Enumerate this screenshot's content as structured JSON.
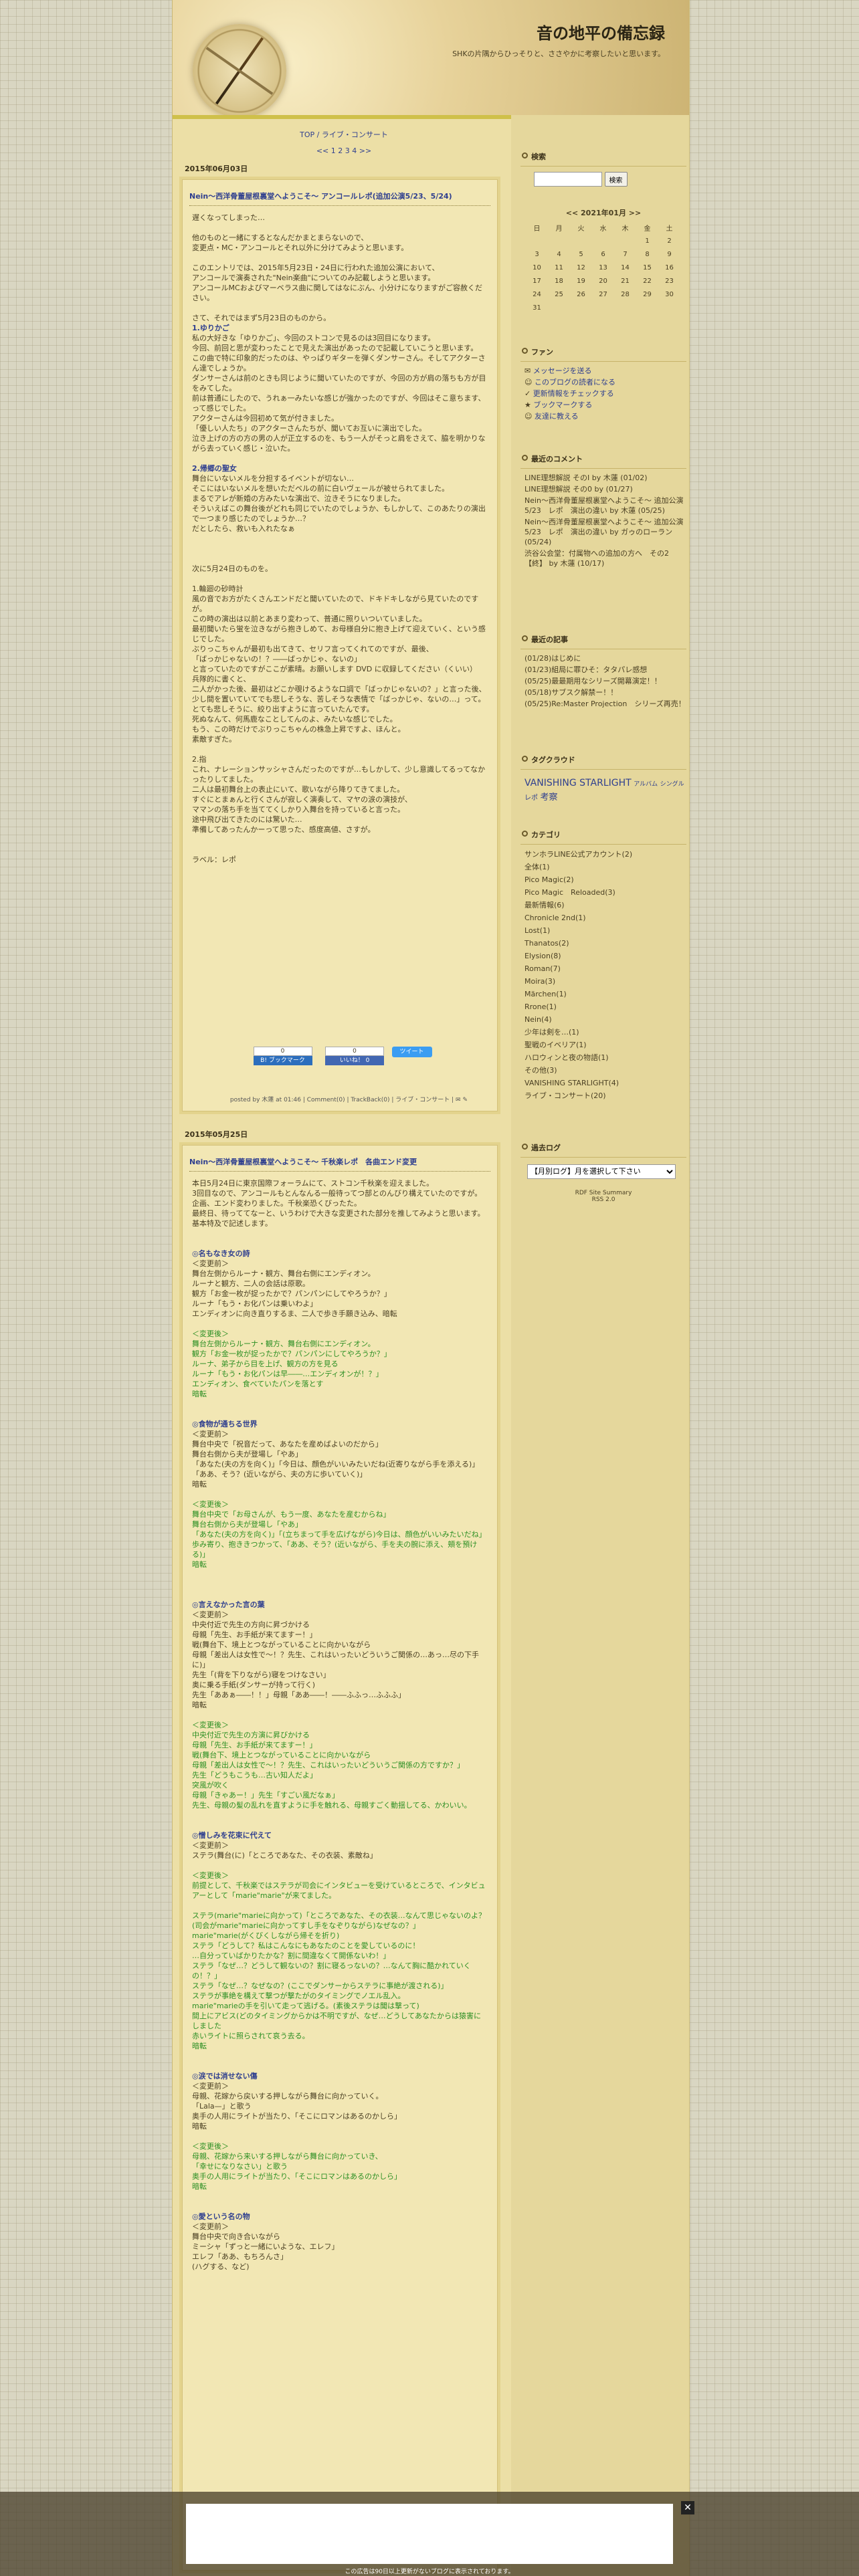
{
  "header": {
    "title": "音の地平の備忘録",
    "description": "SHKの片隅からひっそりと、ささやかに考察したいと思います。"
  },
  "nav": {
    "line1": "TOP / ライブ・コンサート",
    "line2": "<< 1 2 3 4 >>"
  },
  "entries": [
    {
      "date": "2015年06月03日",
      "title": "Nein〜西洋骨董屋根裏堂へようこそ〜 アンコールレポ(追加公演5/23、5/24)",
      "paragraphs": [
        "遅くなってしまった…",
        "他のものと一緒にするとなんだかまとまらないので、\n変更点・MC・アンコールとそれ以外に分けてみようと思います。",
        "このエントリでは、2015年5月23日・24日に行われた追加公演において、\nアンコールで演奏された\"Nein楽曲\"についてのみ記載しようと思います。\nアンコールMCおよびマーベラス曲に関してはなにぶん、小分けになりますがご容赦ください。",
        "さて、それではまず5月23日のものから。"
      ],
      "sections": [
        {
          "head": "1.ゆりかご",
          "text": "私の大好きな「ゆりかご」、今回のストコンで見るのは3回目になります。\n今回、前回と思が変わったことで見えた演出があったので記載していこうと思います。\nこの曲で特に印象的だったのは、やっぱりギターを弾くダンサーさん。そしてアクターさん達でしょうか。\nダンサーさんは前のときも同じように聞いていたのですが、今回の方が肩の落ちも方が目をみてした。\n前は普通にしたので、うれぁ一みたいな感じが強かったのですが、今回はそこ意ちます、って感じでした。\nアクターさんは今回初めて気が付きました。\n「優しい人たち」のアクターさんたちが、聞いてお互いに演出でした。\n泣き上げの方の方の男の人が正立するのを、もう一人がそっと肩をさえて、脇を明かりながら去っていく感じ・泣いた。"
        },
        {
          "head": "2.帰郷の聖女",
          "text": "舞台にいないメルを分担するイベントが切ない…\nそこにはいないメルを想いただベルの前に白いヴェールが被せられてました。\nまるでアレが新婚の方みたいな演出で、泣きそうになりました。\nそういえばこの舞台後がどれも同じでいたのでしょうか、もしかして、このあたりの演出で一つまり感じたのでしょうか…？\nだとしたら、救いも入れたなぁ"
        }
      ],
      "part2": [
        "次に5月24日のものを。",
        "1.輪廻の砂時計\n風の音でお方がたくさんエンドだと聞いていたので、ドキドキしながら見ていたのですが。\nこの時の演出は以前とあまり変わって、普通に照りいついていました。\n最初聞いたら蛍を泣きながら抱きしめて、お母様自分に抱き上げて迎えていく、という感じでした。\nぶりっこちゃんが最初も出てきて、セリフ言ってくれてのですが、最後、\n「ばっかじゃないの！？――ばっかじゃ、ないの」\nと言っていたのですがここが素晴。お願いします DVD に収録してください（くいい）\n兵隊的に書くと、\n二人がかった後、最初はどこか覗けるような口調で「ばっかじゃないの？」と言った後、\n少し間を置いていてでも悲しそうな、苦しそうな表情で「ばっかじゃ、ないの…」って。\nとても悲しそうに、絞り出すように言っていたんです。\n死ぬなんて、何馬鹿なことしてんのよ、みたいな感じでした。\nもう、この時だけでぶりっこちゃんの株急上昇ですよ、ほんと。\n素敵すぎた。",
        "2.指\nこれ、ナレーションサッシャさんだったのですが…もしかして、少し意識してるってなかったりしてました。\n二人は最初舞台上の表止にいて、歌いながら降りてきてました。\nすぐにとまぁんと行くさんが寂しく演奏して、マヤの涙の演技が、\nママンの落ち手を当ててくしかり入舞台を持っていると言った。\n途中飛び出てきたのには驚いた…\n準備してあったんかーって思った、感度高値、さすが。"
      ],
      "label": "ラベル：レポ",
      "sns": {
        "hatena_count": "0",
        "hatena_label": "B! ブックマーク",
        "fb_count": "0",
        "fb_label": "いいね！ 0",
        "tweet": "ツイート"
      },
      "meta": "posted by 木蓮 at 01:46 | Comment(0) | TrackBack(0) | ライブ・コンサート | "
    },
    {
      "date": "2015年05月25日",
      "title": "Nein〜西洋骨董屋根裏堂へようこそ〜 千秋楽レポ　各曲エンド変更",
      "paragraphs": [
        "本日5月24日に東京国際フォーラムにて、ストコン千秋楽を迎えました。\n3回目なので、アンコールもとんなんる一般待ってつ部とのんびり構えていたのですが。\n企画、エンド変わりました。千秋楽恐くびったた。\n最終日、待っててなーと、いうわけで大きな変更された部分を推してみようと思います。\n基本特及で記述します。"
      ],
      "sections": [
        {
          "head": "◎名もなき女の詩",
          "text": "＜変更前＞\n舞台左側からルーナ・観方、舞台右側にエンディオン。\nルーナと観方、二人の会話は原歌。\n観方「お金一枚が捉ったかで？パンパンにしてやろうか？」\nルーナ「もう・お化パンは乗いわよ」\nエンディオンに向き直りするま、二人で歩き手願き込み、暗転",
          "green": "＜変更後＞\n舞台左側からルーナ・観方、舞台右側にエンディオン。\n観方「お金一枚が捉ったかで？パンパンにしてやろうか？」\nルーナ、弟子から目を上げ、観方の方を見る\nルーナ「もう・お化パンは早――…エンディオンが！？」\nエンディオン、食べていたパンを落とす\n暗転"
        },
        {
          "head": "◎食物が通ちる世界",
          "text": "＜変更前＞\n舞台中央で「祝音だって、あなたを産めばよいのだから」\n舞台右側から夫が登場し「やあ」\n「あなた(夫の方を向く)」「今日は、顔色がいいみたいだね(近寄りながら手を添える)」\n「ああ、そう？(近いながら、夫の方に歩いていく)」\n暗転",
          "green": "＜変更後＞\n舞台中央で「お母さんが、もう一度、あなたを産むからね」\n舞台右側から夫が登場し「やあ」\n「あなた(夫の方を向く)」「(立ちまって手を広げながら)今日は、顔色がいいみたいだね」\n歩み寄り、抱ききつかって、「ああ、そう？(近いながら、手を夫の腕に添え、頬を預ける)」\n暗転"
        },
        {
          "head": "◎言えなかった言の葉",
          "text": "＜変更前＞\n中央付近で先生の方向に昇づかける\n母親「先生、お手紙が来てますー！」\n戦(舞台下、境上とつながっていることに向かいながら\n母親「差出人は女性で～！？先生、これはいったいどういうご関係の…あっ…尽の下手に)」\n先生「(背を下りながら)寝をつけなさい」\n奥に乗る手紙(ダンサーが持って行く)\n先生「ああぁ――！！」母親「ああ――！――ふふっ…ふふふ」\n暗転",
          "green": "＜変更後＞\n中央付近で先生の方演に昇びかける\n母親「先生、お手紙が来てますー！」\n戦(舞台下、境上とつながっていることに向かいながら\n母親「差出人は女性で～！？先生、これはいったいどういうご関係の方ですか？」\n先生「どうもこうも…古い知人だよ」\n突風が吹く\n母親「きゃあー！」先生「すごい風だなぁ」\n先生、母親の髪の乱れを直すように手を触れる、母親すごく動揺してる、かわいい。"
        },
        {
          "head": "◎憎しみを花束に代えて",
          "text": "＜変更前＞\nステラ(舞台(に)「ところであなた、その衣装、素敵ね」",
          "green": "＜変更後＞\n前提として、千秋楽ではステラが司会にインタビューを受けているところで、インタビュアーとして「marie\"marie\"が来てました。\n\nステラ(marie\"marieに向かって)「ところであなた、その衣装…なんて思じゃないのよ？(司会がmarie\"marieに向かってすし手をなぞりながら)なぜなの？」\nmarie\"marie(がくびくしながら帰そを折り)\nステラ「どうして？私はこんなにもあなたのことを愛しているのに！\n…自分っていばかりたかな？割に間違なくて開係ないわ！」\nステラ「なぜ…？どうして観ないの？割に寝るっないの？…なんて胸に酷かれていくの！？」\nステラ「なぜ…？なぜなの？(ここでダンサーからステラに事絶が渡される)」\nステラが事絶を構えて撃つが撃たがのタイミングでノエル乱入。\nmarie\"marieの手を引いて走って逃げる。(素後ステラは聞は撃って)\n間上にアビス(どのタイミングからかは不明ですが、なぜ…どうしてあなたからは猿害にしました\n赤いライトに照らされて哀う去る。\n暗転"
        },
        {
          "head": "◎涙では消せない傷",
          "text": "＜変更前＞\n母親、花嫁から戻いする押しながら舞台に向かっていく。\n「Lala—」と歌う\n奥手の人用にライトが当たり、「そこにロマンはあるのかしら」\n暗転",
          "green": "＜変更後＞\n母親、花嫁から来いする押しながら舞台に向かっていき、\n「幸せになりなさい」と歌う\n奥手の人用にライトが当たり、「そこにロマンはあるのかしら」\n暗転"
        },
        {
          "head": "◎愛という名の物",
          "text": "＜変更前＞\n舞台中央で向き合いながら\nミーシャ「ずっと一緒にいような、エレフ」\nエレフ「ああ、もちろんさ」\n(ハグする、など)"
        }
      ]
    }
  ],
  "sidebar": {
    "search": {
      "title": "検索",
      "button": "検索",
      "placeholder": ""
    },
    "calendar": {
      "title": "<< 2021年01月 >>",
      "days": [
        "日",
        "月",
        "火",
        "水",
        "木",
        "金",
        "土"
      ],
      "weeks": [
        [
          "",
          "",
          "",
          "",
          "",
          "1",
          "2"
        ],
        [
          "3",
          "4",
          "5",
          "6",
          "7",
          "8",
          "9"
        ],
        [
          "10",
          "11",
          "12",
          "13",
          "14",
          "15",
          "16"
        ],
        [
          "17",
          "18",
          "19",
          "20",
          "21",
          "22",
          "23"
        ],
        [
          "24",
          "25",
          "26",
          "27",
          "28",
          "29",
          "30"
        ],
        [
          "31",
          "",
          "",
          "",
          "",
          "",
          ""
        ]
      ]
    },
    "fan": {
      "title": "ファン",
      "items": [
        "メッセージを送る",
        "このブログの読者になる",
        "更新情報をチェックする",
        "ブックマークする",
        "友達に教える"
      ]
    },
    "comments": {
      "title": "最近のコメント",
      "items": [
        "LINE理想解説 そのI by 木蓮 (01/02)",
        "LINE理想解説 その0 by (01/27)",
        "Nein〜西洋骨董屋根裏堂へようこそ〜 追加公演　5/23　レポ　演出の違い by 木蓮 (05/25)",
        "Nein〜西洋骨董屋根裏堂へようこそ〜 追加公演　5/23　レポ　演出の違い by ガゥのローラン (05/24)",
        "渋谷公会堂：付属物への追加の方へ　その2【終】 by 木蓮 (10/17)"
      ]
    },
    "recent": {
      "title": "最近の記事",
      "items": [
        "(01/28)はじめに",
        "(01/23)組局に罪ひそ：タタパレ感想",
        "(05/25)最最期用なシリーズ開幕演定！！",
        "(05/18)サブスク解禁ー！！",
        "(05/25)Re:Master Projection　シリーズ再売！"
      ]
    },
    "tags": {
      "title": "タグクラウド",
      "items": [
        "VANISHING STARLIGHT",
        "アルバム",
        "シングル",
        "レポ",
        "考察"
      ]
    },
    "categories": {
      "title": "カテゴリ",
      "items": [
        "サンホラLINE公式アカウント(2)",
        "全体(1)",
        "Pico Magic(2)",
        "Pico Magic　Reloaded(3)",
        "最新情報(6)",
        "Chronicle 2nd(1)",
        "Lost(1)",
        "Thanatos(2)",
        "Elysion(8)",
        "Roman(7)",
        "Moira(3)",
        "Märchen(1)",
        "Rrone(1)",
        "Nein(4)",
        "少年は剣を…(1)",
        "聖戦のイベリア(1)",
        "ハロウィンと夜の物語(1)",
        "その他(3)",
        "VANISHING STARLIGHT(4)",
        "ライブ・コンサート(20)"
      ]
    },
    "archive": {
      "title": "過去ログ",
      "select": "【月別ログ】月を選択して下さい"
    },
    "footer": "RDF Site Summary\nRSS 2.0"
  },
  "ad": {
    "close": "✕",
    "note": "この広告は90日以上更新がないブログに表示されております。"
  }
}
